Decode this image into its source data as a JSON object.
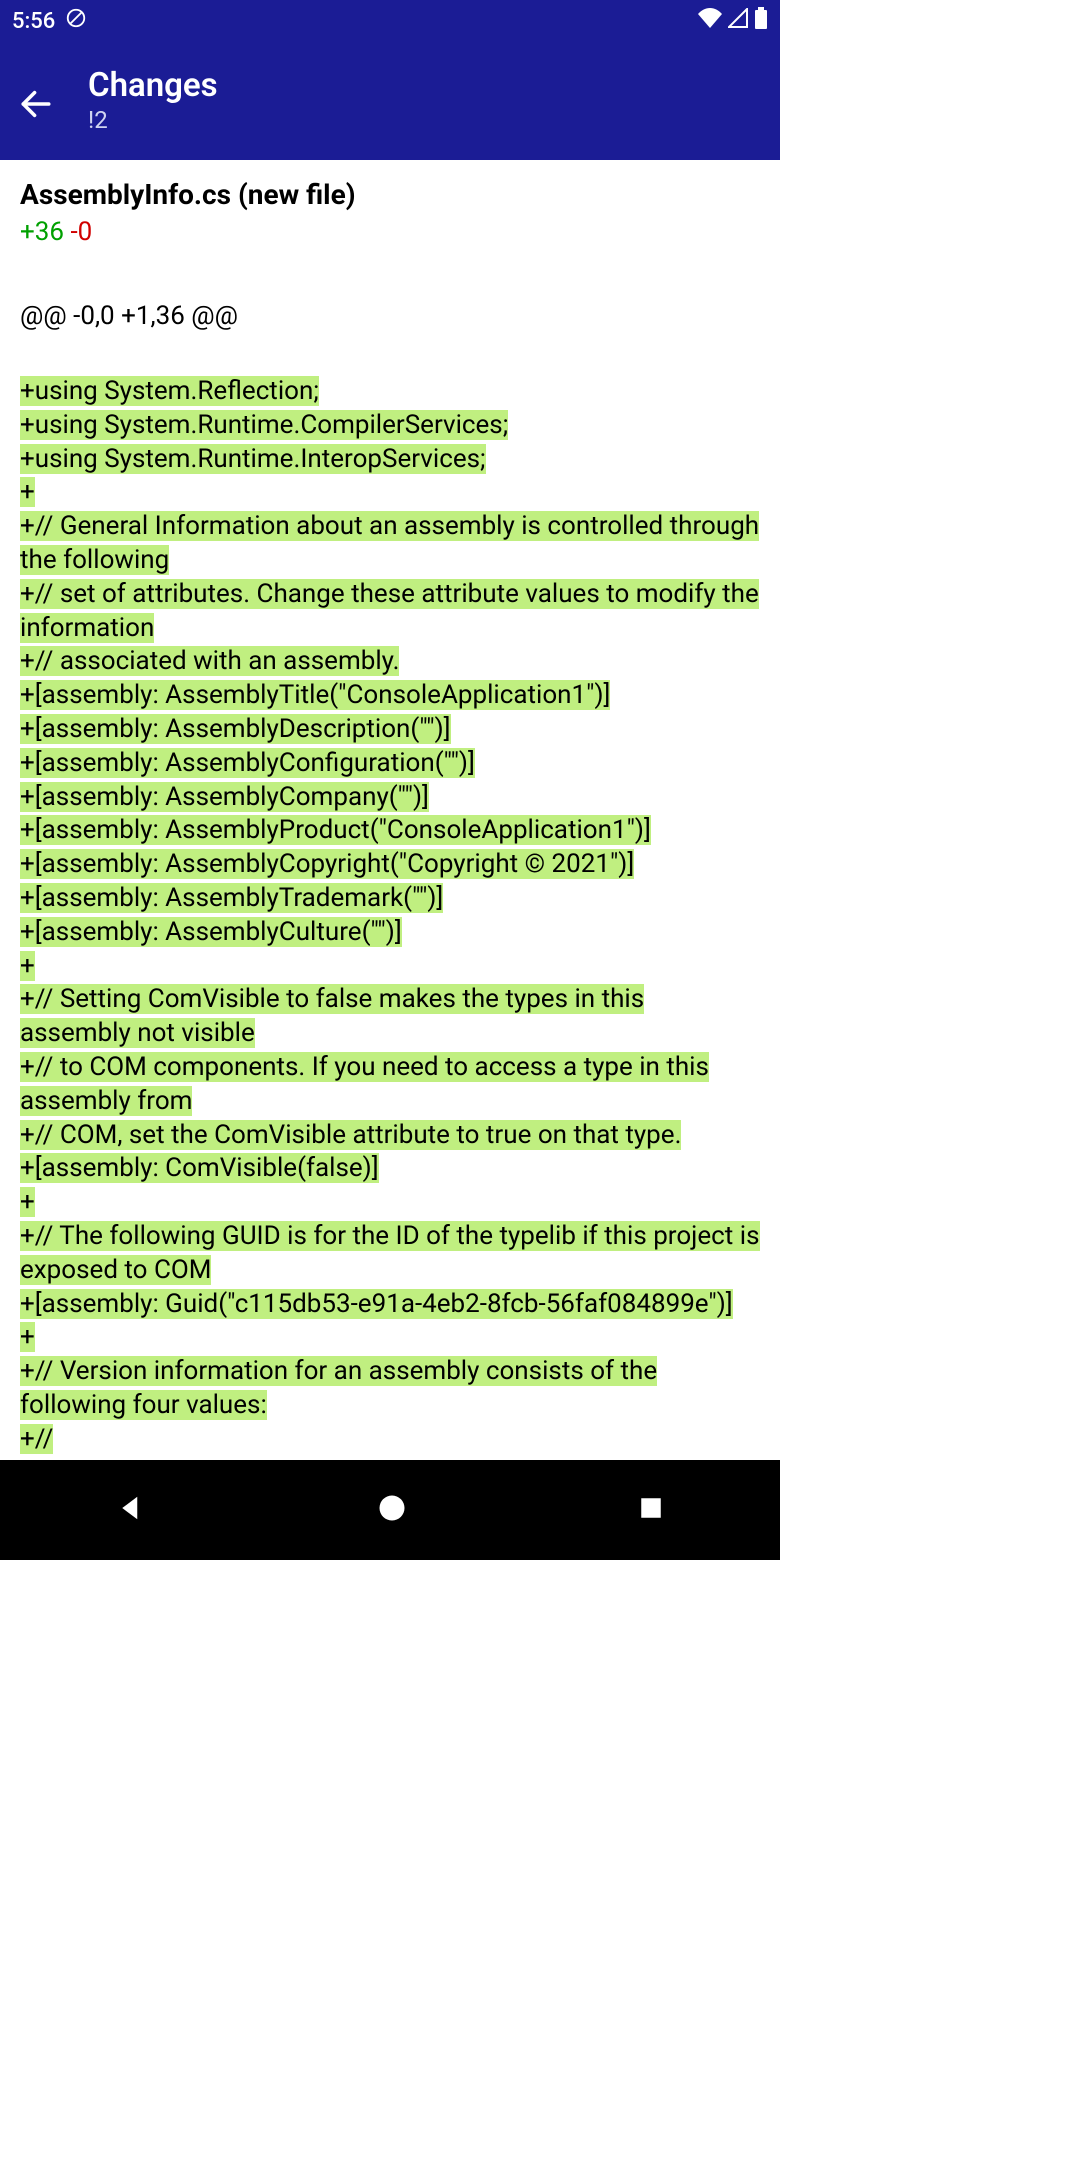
{
  "status": {
    "time": "5:56"
  },
  "appbar": {
    "title": "Changes",
    "subtitle": "!2"
  },
  "file": {
    "header": "AssemblyInfo.cs (new file)",
    "added": "+36",
    "removed": "-0"
  },
  "hunk": "@@ -0,0 +1,36 @@",
  "lines": [
    "+using System.Reflection;",
    "+using System.Runtime.CompilerServices;",
    "+using System.Runtime.InteropServices;",
    "+",
    "+// General Information about an assembly is controlled through the following",
    "+// set of attributes. Change these attribute values to modify the information",
    "+// associated with an assembly.",
    "+[assembly: AssemblyTitle(\"ConsoleApplication1\")]",
    "+[assembly: AssemblyDescription(\"\")]",
    "+[assembly: AssemblyConfiguration(\"\")]",
    "+[assembly: AssemblyCompany(\"\")]",
    "+[assembly: AssemblyProduct(\"ConsoleApplication1\")]",
    "+[assembly: AssemblyCopyright(\"Copyright ©  2021\")]",
    "+[assembly: AssemblyTrademark(\"\")]",
    "+[assembly: AssemblyCulture(\"\")]",
    "+",
    "+// Setting ComVisible to false makes the types in this assembly not visible",
    "+// to COM components.  If you need to access a type in this assembly from",
    "+// COM, set the ComVisible attribute to true on that type.",
    "+[assembly: ComVisible(false)]",
    "+",
    "+// The following GUID is for the ID of the typelib if this project is exposed to COM",
    "+[assembly: Guid(\"c115db53-e91a-4eb2-8fcb-56faf084899e\")]",
    "+",
    "+// Version information for an assembly consists of the following four values:",
    "+//"
  ]
}
